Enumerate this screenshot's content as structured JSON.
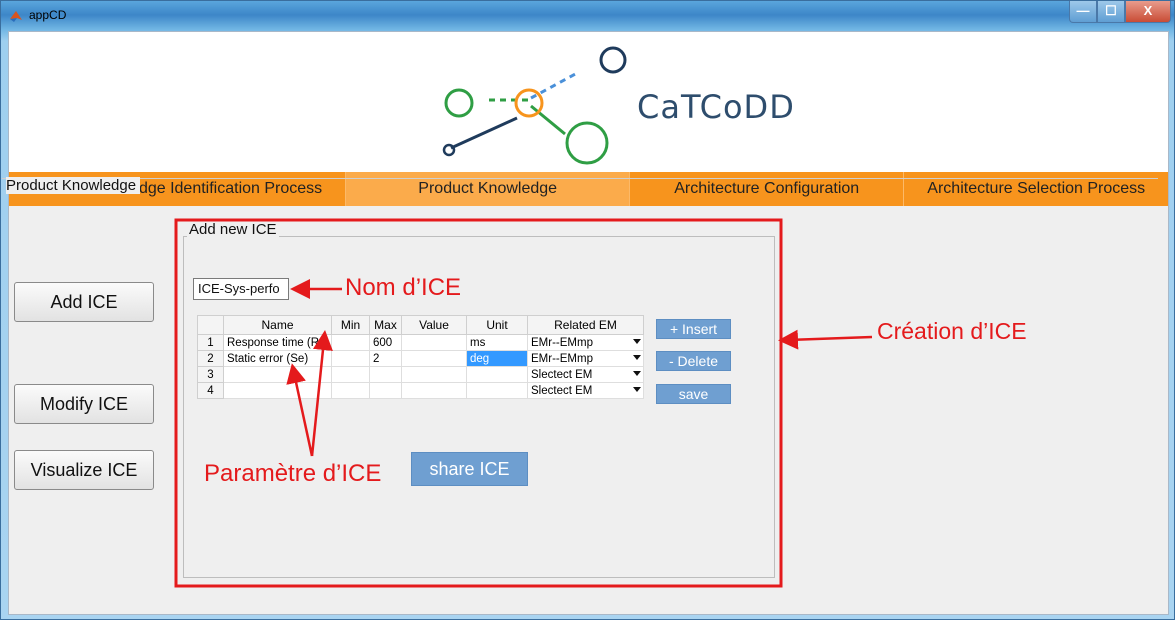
{
  "window": {
    "title": "appCD",
    "icon": "matlab-icon",
    "controls": {
      "minimize": "—",
      "maximize": "☐",
      "close": "X"
    }
  },
  "banner": {
    "logo_text": "CaTCoDD",
    "colors": {
      "green": "#2f9e44",
      "orange": "#f7941d",
      "navy": "#1f3b5c",
      "blue": "#4a90d9"
    }
  },
  "tabs": [
    {
      "label": "Crucial Knwoledge Identification Process"
    },
    {
      "label": "Product Knowledge"
    },
    {
      "label": "Architecture Configuration"
    },
    {
      "label": "Architecture Selection Process"
    }
  ],
  "panel": {
    "title": "Product Knowledge",
    "buttons": {
      "add": "Add ICE",
      "modify": "Modify ICE",
      "visualize": "Visualize ICE"
    }
  },
  "ice_group": {
    "title": "Add new ICE",
    "name_value": "ICE-Sys-perfo",
    "table": {
      "columns": [
        "Name",
        "Min",
        "Max",
        "Value",
        "Unit",
        "Related EM"
      ],
      "rows": [
        {
          "num": "1",
          "name": "Response time (Rt)",
          "min": "",
          "max": "600",
          "value": "",
          "unit": "ms",
          "em": "EMr--EMmp"
        },
        {
          "num": "2",
          "name": "Static error (Se)",
          "min": "",
          "max": "2",
          "value": "",
          "unit": "deg",
          "em": "EMr--EMmp"
        },
        {
          "num": "3",
          "name": "",
          "min": "",
          "max": "",
          "value": "",
          "unit": "",
          "em": "Slectect EM"
        },
        {
          "num": "4",
          "name": "",
          "min": "",
          "max": "",
          "value": "",
          "unit": "",
          "em": "Slectect EM"
        }
      ]
    },
    "insert": "+ Insert",
    "delete": "- Delete",
    "save": "save",
    "share": "share ICE"
  },
  "annotations": {
    "nom": "Nom d’ICE",
    "creation": "Création d’ICE",
    "parametre": "Paramètre d’ICE",
    "color": "#e41a1c"
  }
}
